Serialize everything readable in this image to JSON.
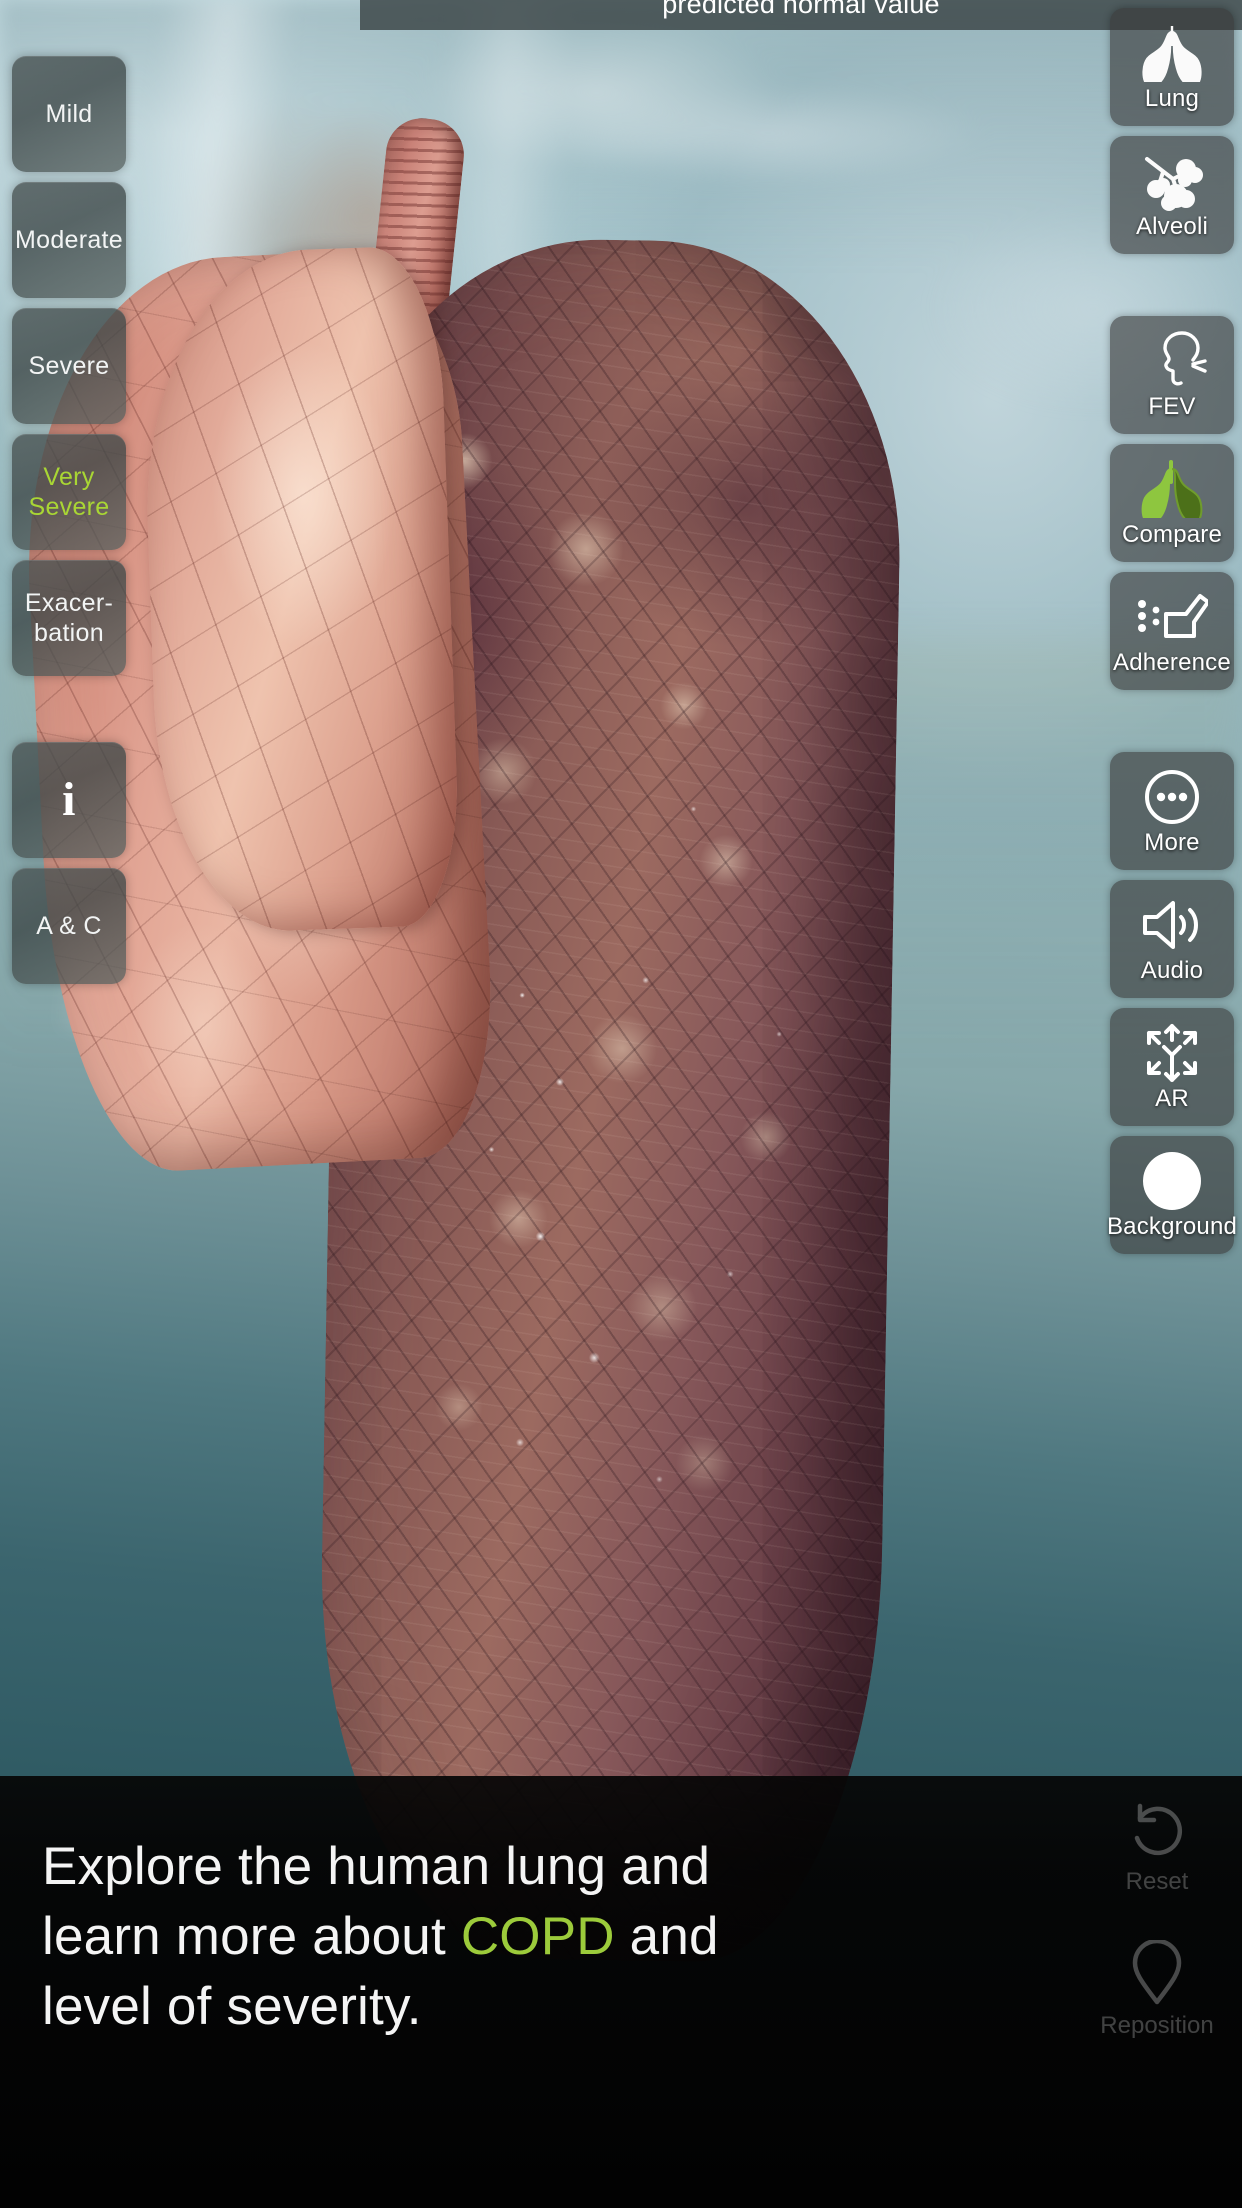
{
  "top_banner": {
    "text": "predicted normal value"
  },
  "severity_rail": {
    "items": [
      {
        "label": "Mild",
        "icon": "text-label",
        "active": false
      },
      {
        "label": "Moderate",
        "icon": "text-label",
        "active": false
      },
      {
        "label": "Severe",
        "icon": "text-label",
        "active": false
      },
      {
        "label": "Very\nSevere",
        "icon": "text-label",
        "active": true
      },
      {
        "label": "Exacer-\nbation",
        "icon": "text-label",
        "active": false
      },
      {
        "label": "i",
        "icon": "info-icon",
        "active": false
      },
      {
        "label": "A & C",
        "icon": "text-label",
        "active": false
      }
    ]
  },
  "tool_rail": {
    "items": [
      {
        "label": "Lung",
        "icon": "lungs-icon"
      },
      {
        "label": "Alveoli",
        "icon": "alveoli-icon"
      },
      {
        "label": "FEV",
        "icon": "head-exhale-icon"
      },
      {
        "label": "Compare",
        "icon": "compare-lungs-icon"
      },
      {
        "label": "Adherence",
        "icon": "inhaler-icon"
      },
      {
        "label": "More",
        "icon": "more-dots-icon"
      },
      {
        "label": "Audio",
        "icon": "speaker-icon"
      },
      {
        "label": "AR",
        "icon": "ar-arrows-icon"
      },
      {
        "label": "Background",
        "icon": "background-circle-icon"
      }
    ]
  },
  "caption": {
    "part1": "Explore the human lung and learn more about ",
    "highlight": "COPD",
    "part2": " and level of severity."
  },
  "bottom_actions": {
    "items": [
      {
        "label": "Reset",
        "icon": "undo-circle-icon"
      },
      {
        "label": "Reposition",
        "icon": "map-pin-icon"
      }
    ]
  },
  "colors": {
    "accent_green": "#a9d634",
    "caption_highlight": "#9ccb3b",
    "panel_bg": "rgba(56,56,56,.62)",
    "bottom_bar": "#020202",
    "background_swatch": "#ffffff"
  }
}
